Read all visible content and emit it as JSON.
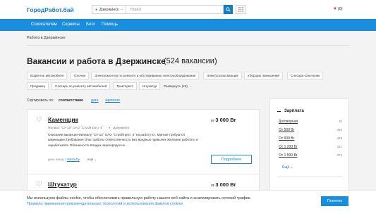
{
  "header": {
    "logo": "ГородРабот.бай",
    "city": "Дзержинск",
    "search_placeholder": "Поиск",
    "favorites": "(0)",
    "icons": [
      "pin-icon",
      "chevron-down-icon",
      "search-icon",
      "grid-icon",
      "heart-icon"
    ]
  },
  "nav": {
    "items": [
      {
        "label": "Соискателям"
      },
      {
        "label": "Сервисы"
      },
      {
        "label": "Блог"
      },
      {
        "label": "Помощь"
      }
    ]
  },
  "breadcrumb": "Работа в Дзержинске",
  "page": {
    "title": "Вакансии и работа в Дзержинске",
    "count": "(524 вакансии)"
  },
  "tags": {
    "row1": [
      "Водитель автомобиля",
      "Грузчик",
      "Электромонтер по ремонту и обслуживанию электрооборудования",
      "Электрогазосварщик",
      "Уборщик помещений",
      "Слесарь-сантехник"
    ],
    "row2": [
      "Продавец",
      "Слесарь по ремонту автомобилей",
      "Тракторист",
      "Штукатур"
    ],
    "expand": "Развернуть (20)"
  },
  "sort": {
    "label": "Сортировать по:",
    "current": "соответствию",
    "options": [
      "дате",
      "зарплате"
    ]
  },
  "vacancies": [
    {
      "title": "Каменщик",
      "company": "Филиал \"СУ-13\" ОАО \"Стройтрест 4\"",
      "city": "Дзержинск",
      "description": "Описание вакансии Филиалу \"СУ-13\" ОАО \"Стройтрест 4\" на работу в г. Минске требуются каменщики.Требования Опыт работы Ответственность Без вредных привычек Желание работать и зарабатывать Обязанности Кладка перегородок из ...",
      "age_label": "день назад с",
      "age_source": "rabota.by",
      "more": "ещё",
      "salary_prefix": "от",
      "salary": "3 000 Br",
      "button": "Подробнее"
    },
    {
      "title": "Штукатур",
      "salary_prefix": "от",
      "salary": "3 000 Br"
    }
  ],
  "sidebar": {
    "heading": "Зарплата",
    "rows": [
      {
        "label": "Договорная",
        "count": "25"
      },
      {
        "label": "От 500 Br",
        "count": "494"
      },
      {
        "label": "От 900 Br",
        "count": "459"
      },
      {
        "label": "От 1 200 Br",
        "count": "421"
      },
      {
        "label": "От 1 500 Br",
        "count": "373"
      }
    ],
    "more": "Ещё"
  },
  "cookie": {
    "text": "Мы используем файлы cookie, чтобы обеспечивать правильную работу нашего веб-сайта и анализировать сетевой трафик.",
    "link": "Правила применения рекомендательных технологий и использования файлов cookies",
    "button": "Понятно"
  },
  "colors": {
    "brand": "#0f7ec6",
    "nav": "#1a8ede",
    "heart": "#d53a3a"
  }
}
